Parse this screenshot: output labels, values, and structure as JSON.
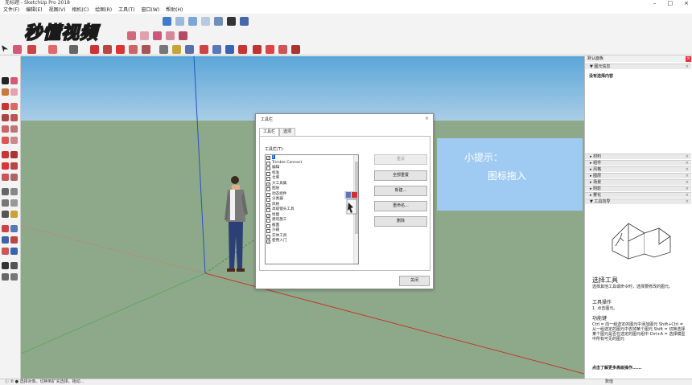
{
  "window": {
    "title": "无标题 - SketchUp Pro 2018",
    "controls": [
      "–",
      "□",
      "×"
    ]
  },
  "menu": [
    "文件(F)",
    "编辑(E)",
    "视图(V)",
    "相机(C)",
    "绘图(R)",
    "工具(T)",
    "窗口(W)",
    "帮助(H)"
  ],
  "watermark": "秒懂视频",
  "hint": {
    "line1": "小提示：",
    "line2": "图标拖入"
  },
  "dialog": {
    "title": "工具栏",
    "close": "×",
    "tabs": [
      "工具栏",
      "选项"
    ],
    "list_label": "工具栏(T):",
    "items": [
      {
        "label": "1",
        "checked": true,
        "selected": true
      },
      {
        "label": "Trimble Connect",
        "checked": false
      },
      {
        "label": "编辑",
        "checked": false
      },
      {
        "label": "标准",
        "checked": false
      },
      {
        "label": "仓库",
        "checked": false
      },
      {
        "label": "大工具集",
        "checked": true
      },
      {
        "label": "图层",
        "checked": false
      },
      {
        "label": "动态组件",
        "checked": false
      },
      {
        "label": "分类器",
        "checked": false
      },
      {
        "label": "风格",
        "checked": true
      },
      {
        "label": "高级镜头工具",
        "checked": false
      },
      {
        "label": "绘图",
        "checked": true
      },
      {
        "label": "建筑施工",
        "checked": false
      },
      {
        "label": "截面",
        "checked": false
      },
      {
        "label": "沙箱",
        "checked": false
      },
      {
        "label": "实体工具",
        "checked": false
      },
      {
        "label": "使用入门",
        "checked": true
      }
    ],
    "buttons": [
      "重设",
      "全部重置",
      "新建...",
      "重命名...",
      "删除"
    ],
    "close_label": "关闭"
  },
  "tray": {
    "title": "默认面板",
    "entity_info": "▼ 图元信息",
    "no_selection": "没有选择内容",
    "sections": [
      "▸ 材料",
      "▸ 组件",
      "▸ 风格",
      "▸ 图层",
      "▸ 场景",
      "▸ 阴影",
      "▸ 雾化",
      "▼ 工具向导"
    ],
    "instructor": {
      "heading": "选择工具",
      "desc": "选择其他工具或命令时，选择要修改的图元。",
      "op_title": "工具操作",
      "op": "1. 点击图元。",
      "keys_title": "功能键",
      "keys": "Ctrl = 向一组选定的图元中添加图元 Shift+Ctrl = 从一组选定的图元中去掉某个图元 Shift = 切换选择某个图元是否在选定的图元组中 Ctrl+A = 选择模型中所有可见的图元",
      "more": "点击了解更多高级操作......"
    }
  },
  "status": {
    "left": "ⓘ ② ●  选择对象。切换到扩充选择。拖动...",
    "right": "数值"
  },
  "colors": {
    "sky": "#5ba6d8",
    "ground": "#8ea98a",
    "hint_bg": "#9fcbf2",
    "selection": "#0a64d6"
  }
}
